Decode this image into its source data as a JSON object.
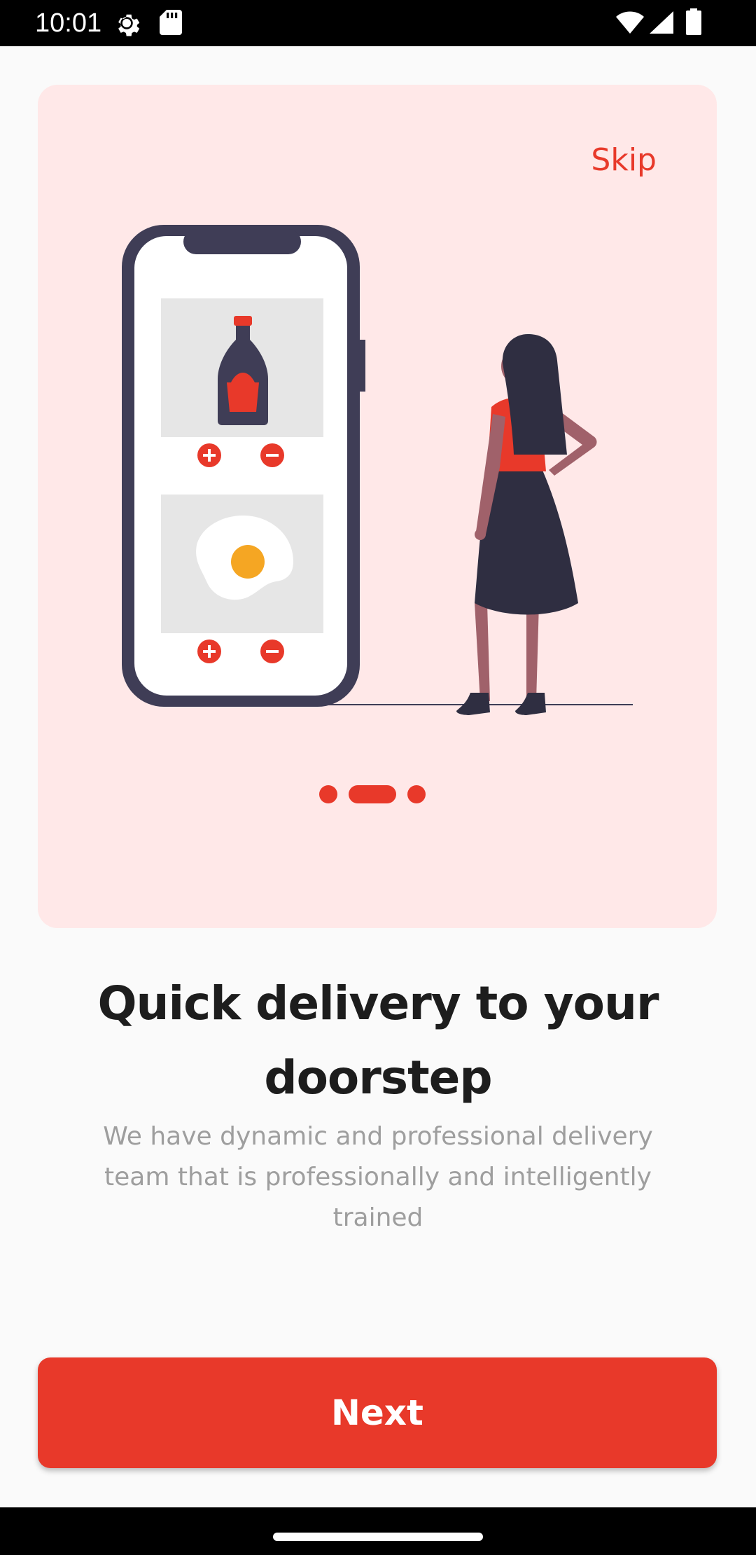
{
  "status_bar": {
    "time": "10:01",
    "icons": [
      "settings-gear-icon",
      "sd-card-icon",
      "wifi-icon",
      "cellular-signal-icon",
      "battery-icon"
    ]
  },
  "onboarding": {
    "skip_label": "Skip",
    "illustration": "phone-with-food-items-and-woman",
    "pager": {
      "total_pages": 3,
      "active_index": 1
    },
    "title": "Quick delivery to your doorstep",
    "subtitle": "We have dynamic and professional delivery team that is professionally and intelligently trained",
    "next_label": "Next"
  },
  "colors": {
    "accent": "#e8392a",
    "card_background": "#ffe8e8",
    "page_background": "#fafafa",
    "title_text": "#1d1d1d",
    "subtitle_text": "#9e9e9e",
    "phone_frame": "#3f3d56"
  }
}
